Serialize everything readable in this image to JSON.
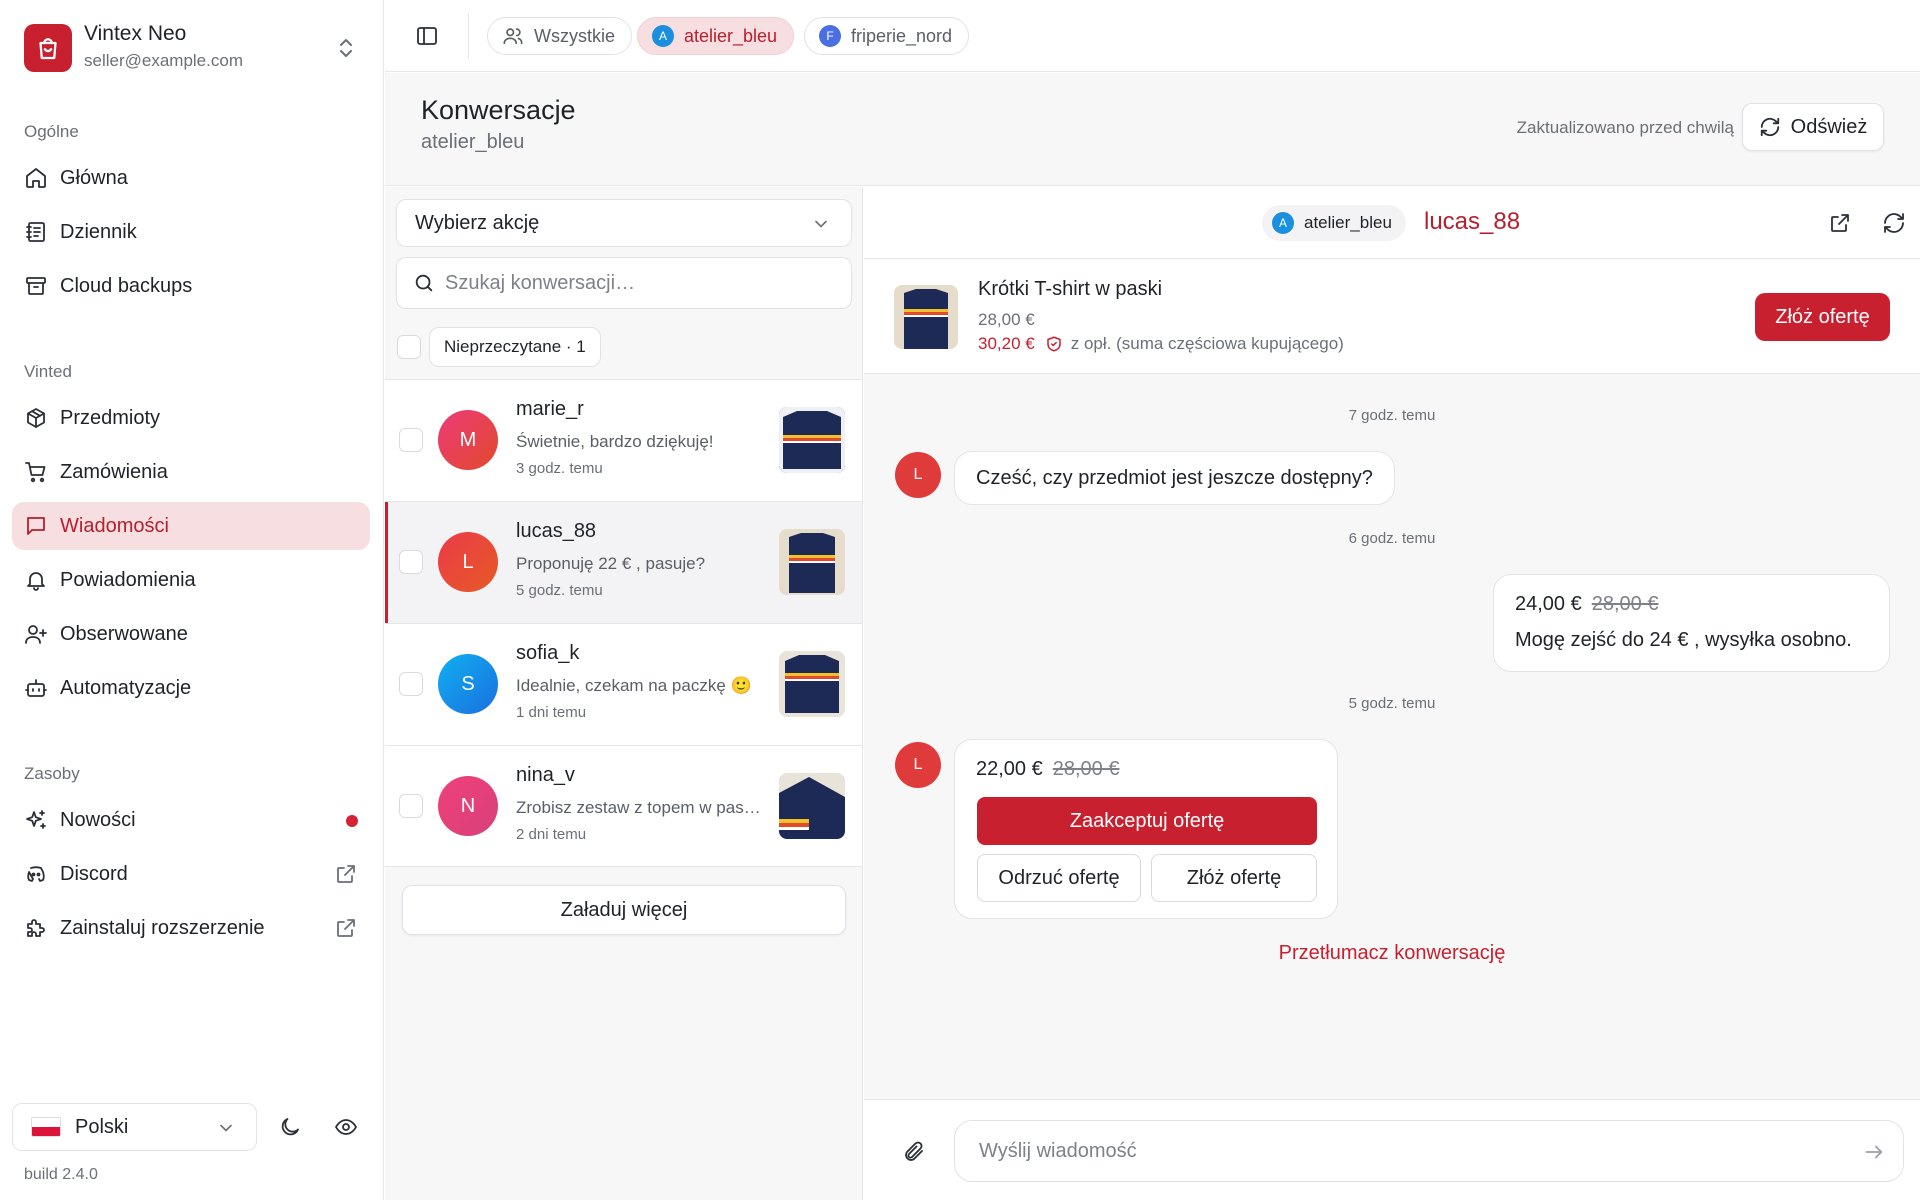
{
  "brand": {
    "name": "Vintex Neo",
    "email": "seller@example.com"
  },
  "sidebar": {
    "sections": [
      {
        "label": "Ogólne"
      },
      {
        "label": "Vinted"
      },
      {
        "label": "Zasoby"
      }
    ],
    "items": [
      {
        "label": "Główna",
        "icon": "home-icon"
      },
      {
        "label": "Dziennik",
        "icon": "journal-icon"
      },
      {
        "label": "Cloud backups",
        "icon": "archive-icon"
      },
      {
        "label": "Przedmioty",
        "icon": "package-icon"
      },
      {
        "label": "Zamówienia",
        "icon": "cart-icon"
      },
      {
        "label": "Wiadomości",
        "icon": "message-icon",
        "active": true
      },
      {
        "label": "Powiadomienia",
        "icon": "bell-icon"
      },
      {
        "label": "Obserwowane",
        "icon": "user-plus-icon"
      },
      {
        "label": "Automatyzacje",
        "icon": "bot-icon"
      },
      {
        "label": "Nowości",
        "icon": "sparkles-icon",
        "badge": "red-dot"
      },
      {
        "label": "Discord",
        "icon": "discord-icon",
        "external": true
      },
      {
        "label": "Zainstaluj rozszerzenie",
        "icon": "puzzle-icon",
        "external": true
      }
    ],
    "language": "Polski",
    "build": "build 2.4.0"
  },
  "topbar": {
    "chips": [
      {
        "label": "Wszystkie",
        "icon": "users-icon"
      },
      {
        "label": "atelier_bleu",
        "initial": "A",
        "active": true
      },
      {
        "label": "friperie_nord",
        "initial": "F"
      }
    ]
  },
  "page": {
    "title": "Konwersacje",
    "subtitle": "atelier_bleu",
    "updated": "Zaktualizowano przed chwilą",
    "refresh_label": "Odśwież"
  },
  "list": {
    "action_placeholder": "Wybierz akcję",
    "search_placeholder": "Szukaj konwersacji…",
    "filter_label": "Nieprzeczytane · 1",
    "load_more": "Załaduj więcej",
    "conversations": [
      {
        "initial": "M",
        "name": "marie_r",
        "message": "Świetnie, bardzo dziękuję!",
        "time": "3 godz. temu",
        "color": "#e0405a"
      },
      {
        "initial": "L",
        "name": "lucas_88",
        "message": "Proponuję 22  € , pasuje?",
        "time": "5 godz. temu",
        "color": "#e5402c",
        "active": true
      },
      {
        "initial": "S",
        "name": "sofia_k",
        "message": "Idealnie, czekam na paczkę 🙂",
        "time": "1 dni temu",
        "color": "#1a8fe0"
      },
      {
        "initial": "N",
        "name": "nina_v",
        "message": "Zrobisz zestaw z topem w paski?",
        "time": "2 dni temu",
        "color": "#e0407a"
      }
    ]
  },
  "chat": {
    "account": {
      "initial": "A",
      "name": "atelier_bleu"
    },
    "user": "lucas_88",
    "item": {
      "title": "Krótki T-shirt w paski",
      "price": "28,00  €",
      "total": "30,20  €",
      "total_note": "z opł. (suma częściowa kupującego)",
      "offer_button": "Złóż ofertę"
    },
    "timestamps": [
      "7 godz. temu",
      "6 godz. temu",
      "5 godz. temu"
    ],
    "messages": [
      {
        "from": "L",
        "text": "Cześć, czy przedmiot jest jeszcze dostępny?"
      },
      {
        "from": "me",
        "offer": "24,00  €",
        "old": "28,00  €",
        "text": "Mogę zejść do 24  € , wysyłka osobno."
      },
      {
        "from": "L",
        "offer": "22,00  €",
        "old": "28,00  €",
        "accept": "Zaakceptuj ofertę",
        "decline": "Odrzuć ofertę",
        "counter": "Złóż ofertę"
      }
    ],
    "translate": "Przetłumacz konwersację",
    "composer_placeholder": "Wyślij wiadomość"
  },
  "colors": {
    "accent": "#c8202f",
    "active_bg": "#f7dfe1",
    "account_blue": "#1a8fe0"
  }
}
